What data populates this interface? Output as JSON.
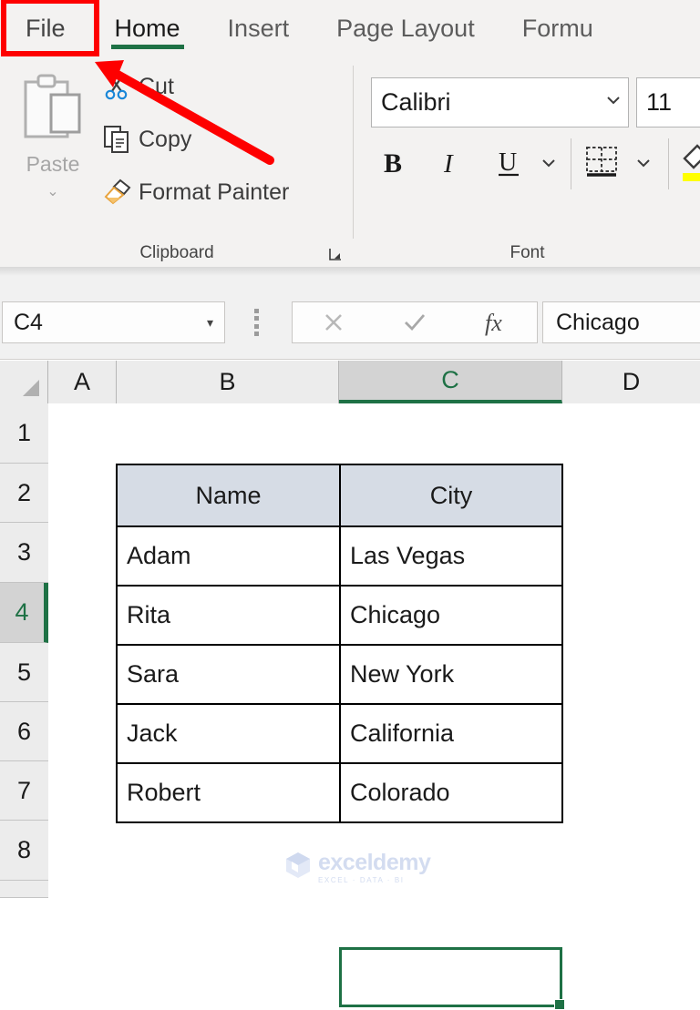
{
  "ribbon": {
    "tabs": [
      {
        "label": "File",
        "active": false
      },
      {
        "label": "Home",
        "active": true
      },
      {
        "label": "Insert",
        "active": false
      },
      {
        "label": "Page Layout",
        "active": false
      },
      {
        "label": "Formu",
        "active": false
      }
    ],
    "accent_color": "#1e7145",
    "groups": {
      "clipboard": {
        "label": "Clipboard",
        "paste_label": "Paste",
        "commands": [
          {
            "label": "Cut",
            "icon": "scissors-icon"
          },
          {
            "label": "Copy",
            "icon": "copy-icon"
          },
          {
            "label": "Format Painter",
            "icon": "paintbrush-icon"
          }
        ]
      },
      "font": {
        "label": "Font",
        "font_name": "Calibri",
        "font_size": "11",
        "bold_label": "B",
        "italic_label": "I",
        "underline_label": "U",
        "border_icon": "borders-icon",
        "fill_icon": "fill-color-icon",
        "highlight_color": "#ffff00"
      }
    }
  },
  "formula_bar": {
    "name_box_value": "C4",
    "name_box_caret": "▾",
    "cancel_icon": "close-icon",
    "enter_icon": "check-icon",
    "function_icon": "fx-icon",
    "formula_value": "Chicago"
  },
  "grid": {
    "columns": [
      "A",
      "B",
      "C",
      "D"
    ],
    "selected_column": "C",
    "rows": [
      "1",
      "2",
      "3",
      "4",
      "5",
      "6",
      "7",
      "8"
    ],
    "selected_row": "4",
    "active_cell": "C4",
    "selection_color": "#1e7145"
  },
  "sheet_table": {
    "headers": [
      "Name",
      "City"
    ],
    "header_fill": "#d6dce5",
    "rows": [
      {
        "name": "Adam",
        "city": "Las Vegas"
      },
      {
        "name": "Rita",
        "city": "Chicago"
      },
      {
        "name": "Sara",
        "city": "New York"
      },
      {
        "name": "Jack",
        "city": "California"
      },
      {
        "name": "Robert",
        "city": "Colorado"
      }
    ]
  },
  "watermark": {
    "brand": "exceldemy",
    "tagline": "EXCEL · DATA · BI",
    "color": "#d3dcf0"
  },
  "annotations": {
    "highlight_color": "#fe0000",
    "target": "File"
  }
}
